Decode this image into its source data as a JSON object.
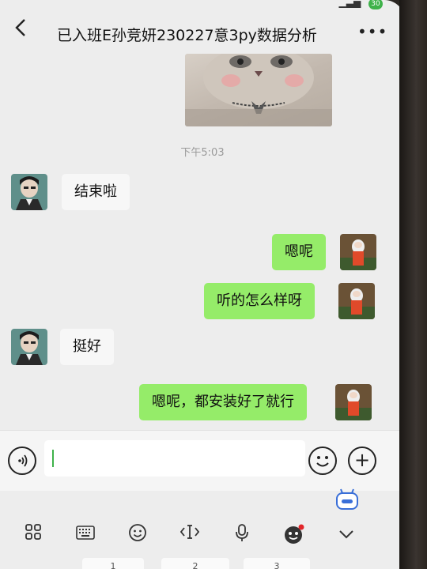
{
  "status": {
    "battery": "30"
  },
  "header": {
    "back_icon": "back-arrow",
    "title": "已入班E孙竞妍230227意3py数据分析",
    "more_label": "•••"
  },
  "chat": {
    "timestamp": "下午5:03",
    "messages": [
      {
        "side": "left",
        "text": "结束啦"
      },
      {
        "side": "right",
        "text": "嗯呢"
      },
      {
        "side": "right",
        "text": "听的怎么样呀"
      },
      {
        "side": "left",
        "text": "挺好"
      },
      {
        "side": "right",
        "text": "嗯呢，都安装好了就行"
      }
    ]
  },
  "input": {
    "voice_icon": "voice-icon",
    "emoji_icon": "emoji-icon",
    "plus_label": "+"
  },
  "keyboard": {
    "keys": [
      "1",
      "2",
      "3"
    ]
  },
  "colors": {
    "sent_bubble": "#95ec69",
    "received_bubble": "#f7f7f7",
    "caret": "#3fb24a",
    "notification_dot": "#e2262a"
  }
}
